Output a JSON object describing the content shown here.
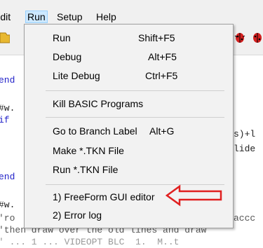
{
  "menubar": {
    "items": [
      {
        "label": "Edit"
      },
      {
        "label": "Run"
      },
      {
        "label": "Setup"
      },
      {
        "label": "Help"
      }
    ]
  },
  "code": {
    "lines": [
      "end",
      "#w.",
      "if",
      "s)+l",
      "lide",
      "end",
      "#w.",
      "'ro",
      "accc",
      "'then draw over the old lines and draw",
      "' ... 1 ... VIDEOPT BLC  1.  M..t"
    ]
  },
  "run_menu": {
    "items": [
      {
        "label": "Run",
        "shortcut": "Shift+F5"
      },
      {
        "label": "Debug",
        "shortcut": "Alt+F5"
      },
      {
        "label": "Lite Debug",
        "shortcut": "Ctrl+F5"
      },
      {
        "label": "Kill BASIC Programs",
        "shortcut": ""
      },
      {
        "label": "Go to Branch Label",
        "shortcut": "Alt+G"
      },
      {
        "label": "Make *.TKN File",
        "shortcut": ""
      },
      {
        "label": "Run *.TKN File",
        "shortcut": ""
      },
      {
        "label": "1) FreeForm GUI editor",
        "shortcut": ""
      },
      {
        "label": "2) Error log",
        "shortcut": ""
      }
    ]
  },
  "colors": {
    "arrow": "#e02020",
    "menu_bg": "#f2f2f2",
    "active_highlight": "#cce8ff",
    "keyword": "#1f1fc8"
  },
  "icons": [
    "folder-open-icon",
    "bug-icon",
    "bug-icon"
  ]
}
